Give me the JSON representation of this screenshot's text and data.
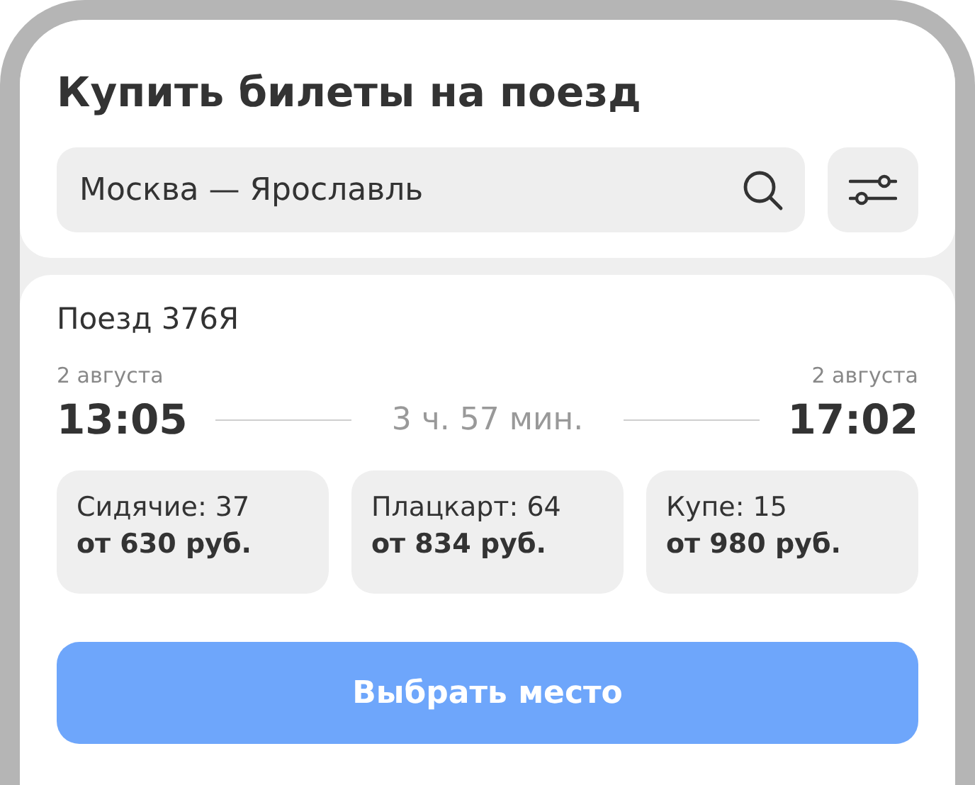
{
  "header": {
    "title": "Купить билеты на поезд",
    "search": {
      "value": "Москва — Ярославль"
    }
  },
  "train": {
    "name": "Поезд 376Я",
    "departure": {
      "date": "2 августа",
      "time": "13:05"
    },
    "duration": "3 ч. 57 мин.",
    "arrival": {
      "date": "2 августа",
      "time": "17:02"
    },
    "classes": [
      {
        "name": "Сидячие: 37",
        "price": "от 630 руб."
      },
      {
        "name": "Плацкарт: 64",
        "price": "от 834 руб."
      },
      {
        "name": "Купе: 15",
        "price": "от 980 руб."
      }
    ],
    "button": "Выбрать место"
  }
}
